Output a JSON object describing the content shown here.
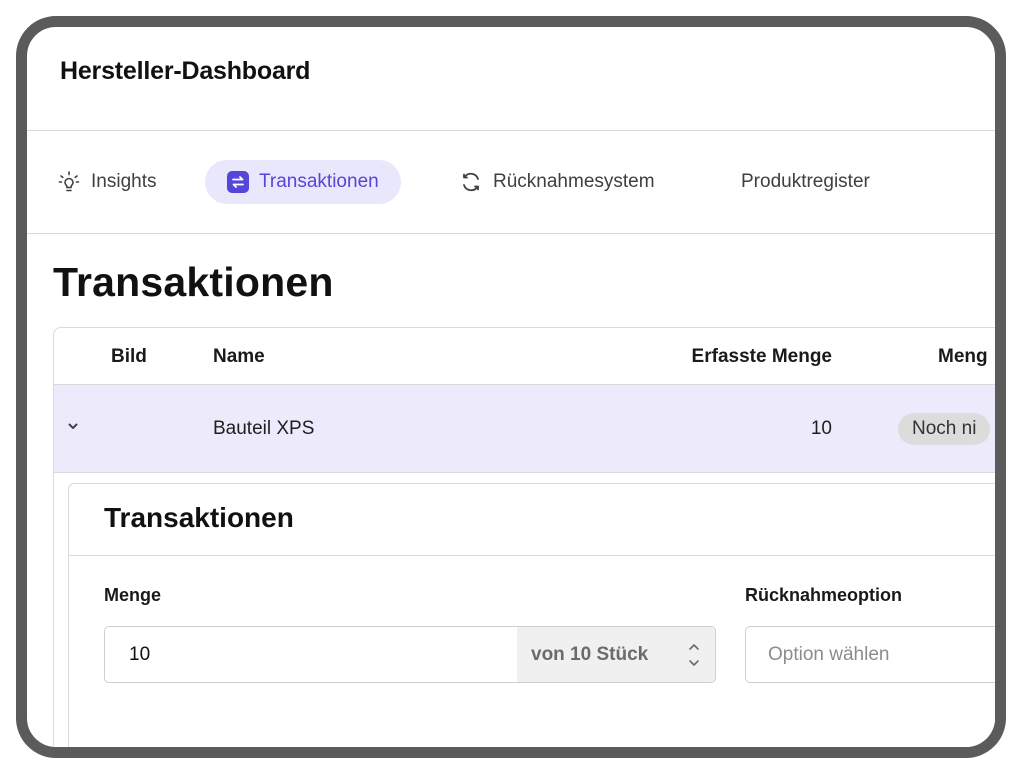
{
  "app": {
    "title": "Hersteller-Dashboard"
  },
  "tabs": [
    {
      "label": "Insights",
      "icon": "lightbulb-icon",
      "active": false
    },
    {
      "label": "Transaktionen",
      "icon": "transactions-icon",
      "active": true
    },
    {
      "label": "Rücknahmesystem",
      "icon": "refresh-icon",
      "active": false
    },
    {
      "label": "Produktregister",
      "icon": "",
      "active": false
    }
  ],
  "page": {
    "title": "Transaktionen"
  },
  "table": {
    "columns": [
      "Bild",
      "Name",
      "Erfasste Menge",
      "Meng"
    ],
    "rows": [
      {
        "name": "Bauteil XPS",
        "erfasste_menge": "10",
        "status": "Noch ni",
        "expanded": true
      }
    ]
  },
  "detail": {
    "title": "Transaktionen",
    "menge_label": "Menge",
    "menge_value": "10",
    "menge_suffix": "von 10 Stück",
    "ruecknahme_label": "Rücknahmeoption",
    "ruecknahme_placeholder": "Option wählen"
  },
  "colors": {
    "accent": "#5346d8",
    "accent_bg": "#e9e7fb",
    "row_selected_bg": "#eceafb",
    "frame_border": "#5b5b5b",
    "badge_bg": "#dcdcdc"
  }
}
